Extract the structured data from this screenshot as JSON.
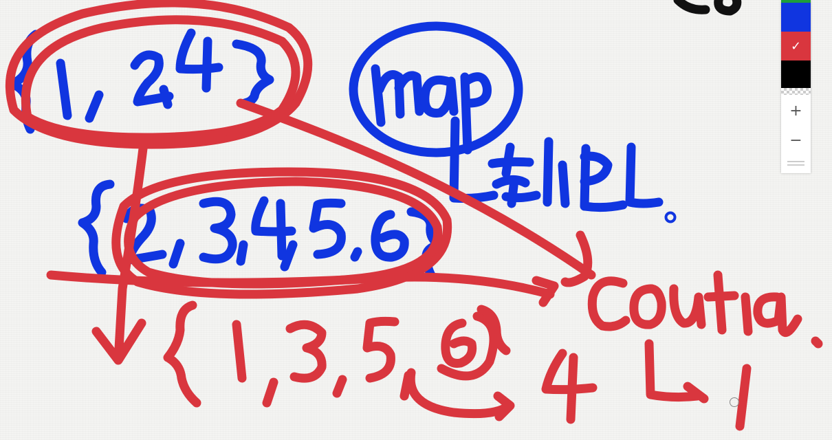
{
  "app": {
    "canvas_background": "#f4f4f2"
  },
  "palette": {
    "colors": [
      {
        "name": "green",
        "hex": "#1e9e3a",
        "selected": false
      },
      {
        "name": "blue",
        "hex": "#1035e0",
        "selected": false
      },
      {
        "name": "red",
        "hex": "#d9363e",
        "selected": true
      },
      {
        "name": "black",
        "hex": "#000000",
        "selected": false
      },
      {
        "name": "transparent",
        "hex": "",
        "selected": false
      }
    ],
    "check_glyph": "✓",
    "zoom_in_glyph": "+",
    "zoom_out_glyph": "−",
    "icons": [
      "checkmark-icon",
      "plus-icon",
      "minus-icon",
      "drag-handle-icon"
    ]
  },
  "ink": {
    "red_hex": "#d9363e",
    "blue_hex": "#1035e0"
  }
}
